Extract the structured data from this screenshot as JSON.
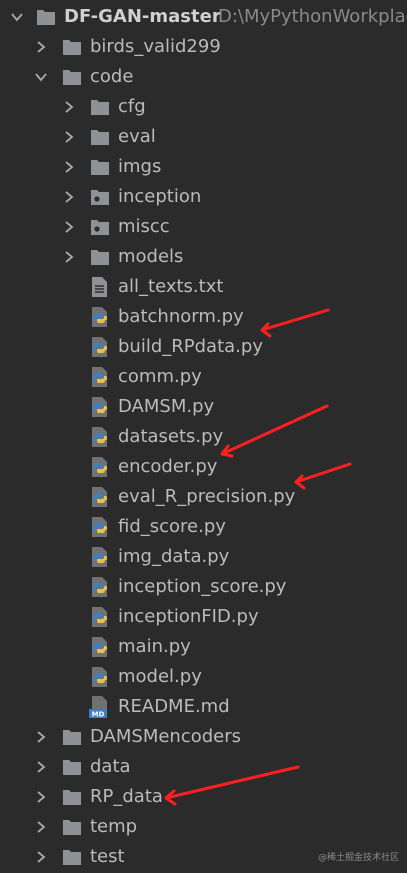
{
  "root": {
    "name": "DF-GAN-master",
    "path": "D:\\MyPythonWorkplac"
  },
  "items": [
    {
      "label": "birds_valid299",
      "type": "folder",
      "depth": 1,
      "expanded": false
    },
    {
      "label": "code",
      "type": "folder",
      "depth": 1,
      "expanded": true
    },
    {
      "label": "cfg",
      "type": "folder",
      "depth": 2,
      "expanded": false
    },
    {
      "label": "eval",
      "type": "folder",
      "depth": 2,
      "expanded": false
    },
    {
      "label": "imgs",
      "type": "folder",
      "depth": 2,
      "expanded": false
    },
    {
      "label": "inception",
      "type": "package",
      "depth": 2,
      "expanded": false
    },
    {
      "label": "miscc",
      "type": "package",
      "depth": 2,
      "expanded": false
    },
    {
      "label": "models",
      "type": "folder",
      "depth": 2,
      "expanded": false
    },
    {
      "label": "all_texts.txt",
      "type": "text",
      "depth": 2
    },
    {
      "label": "batchnorm.py",
      "type": "python",
      "depth": 2
    },
    {
      "label": "build_RPdata.py",
      "type": "python",
      "depth": 2
    },
    {
      "label": "comm.py",
      "type": "python",
      "depth": 2
    },
    {
      "label": "DAMSM.py",
      "type": "python",
      "depth": 2
    },
    {
      "label": "datasets.py",
      "type": "python",
      "depth": 2
    },
    {
      "label": "encoder.py",
      "type": "python",
      "depth": 2
    },
    {
      "label": "eval_R_precision.py",
      "type": "python",
      "depth": 2
    },
    {
      "label": "fid_score.py",
      "type": "python",
      "depth": 2
    },
    {
      "label": "img_data.py",
      "type": "python",
      "depth": 2
    },
    {
      "label": "inception_score.py",
      "type": "python",
      "depth": 2
    },
    {
      "label": "inceptionFID.py",
      "type": "python",
      "depth": 2
    },
    {
      "label": "main.py",
      "type": "python",
      "depth": 2
    },
    {
      "label": "model.py",
      "type": "python",
      "depth": 2
    },
    {
      "label": "README.md",
      "type": "markdown",
      "depth": 2
    },
    {
      "label": "DAMSMencoders",
      "type": "folder",
      "depth": 1,
      "expanded": false
    },
    {
      "label": "data",
      "type": "folder",
      "depth": 1,
      "expanded": false
    },
    {
      "label": "RP_data",
      "type": "folder",
      "depth": 1,
      "expanded": false
    },
    {
      "label": "temp",
      "type": "folder",
      "depth": 1,
      "expanded": false
    },
    {
      "label": "test",
      "type": "folder",
      "depth": 1,
      "expanded": false
    }
  ],
  "md_badge": "MD",
  "watermark": "@稀土掘金技术社区",
  "colors": {
    "background": "#2b2b2b",
    "text": "#bbbbbb",
    "folder": "#8e9297",
    "python_blue": "#3f7fbf",
    "python_yellow": "#e8c14a",
    "arrow": "#ff1f1f"
  }
}
